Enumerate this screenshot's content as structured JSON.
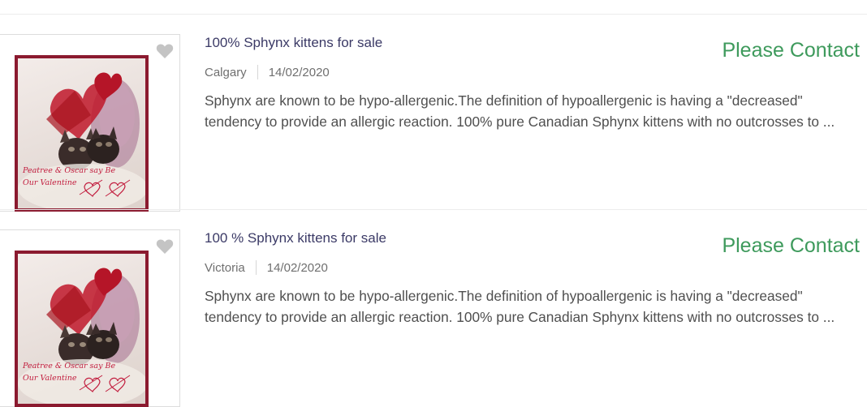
{
  "listings": [
    {
      "title": "100% Sphynx kittens for sale",
      "price": "Please Contact",
      "location": "Calgary",
      "date": "14/02/2020",
      "description": "Sphynx are known to be hypo-allergenic.The definition of hypoallergenic is having a \"decreased\" tendency to provide an allergic reaction. 100% pure Canadian Sphynx kittens with no outcrosses to ...",
      "image_caption_line1": "Peatree & Oscar say Be",
      "image_caption_line2": "Our Valentine",
      "favorite_icon": "heart-icon"
    },
    {
      "title": "100 % Sphynx kittens for sale",
      "price": "Please Contact",
      "location": "Victoria",
      "date": "14/02/2020",
      "description": "Sphynx are known to be hypo-allergenic.The definition of hypoallergenic is having a \"decreased\" tendency to provide an allergic reaction. 100% pure Canadian Sphynx kittens with no outcrosses to ...",
      "image_caption_line1": "Peatree & Oscar say Be",
      "image_caption_line2": "Our Valentine",
      "favorite_icon": "heart-icon"
    }
  ],
  "colors": {
    "price_green": "#3e9a5c",
    "title_navy": "#3b3a66",
    "photo_border": "#8b1a2f",
    "caption_red": "#c21d3e"
  }
}
